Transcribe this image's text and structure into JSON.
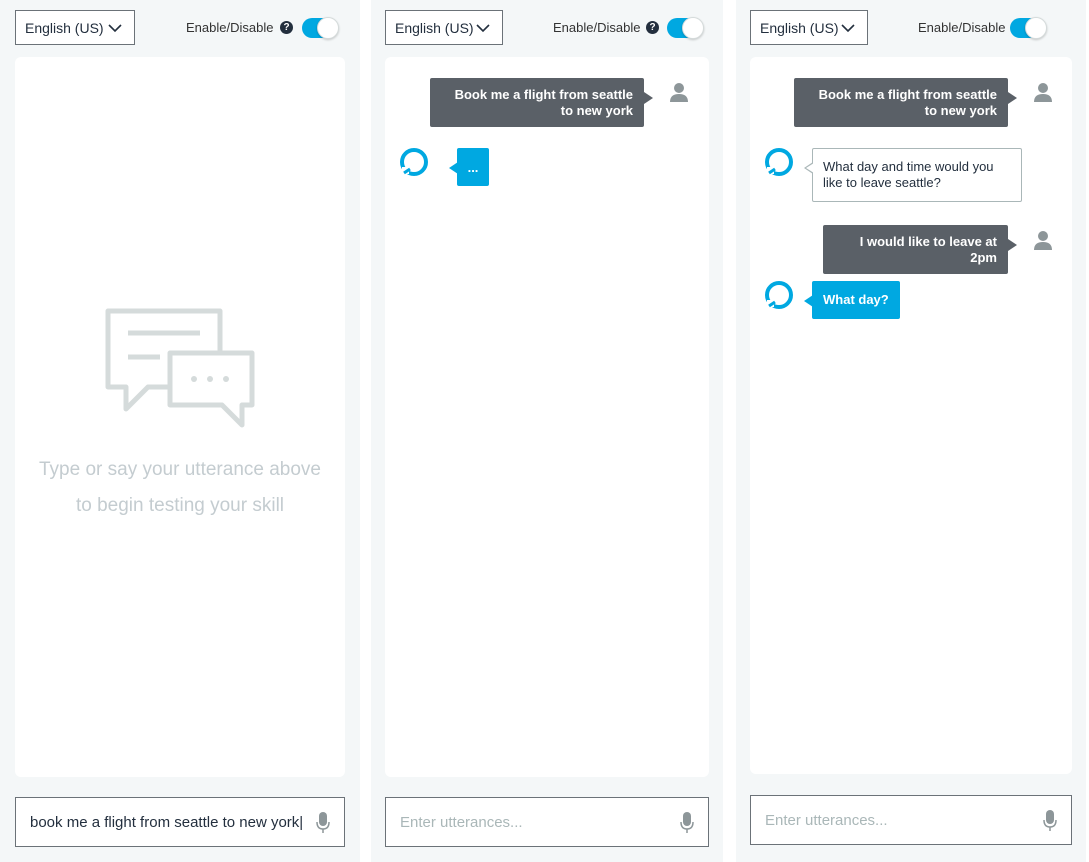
{
  "panels": [
    {
      "language": "English (US)",
      "toggle_label": "Enable/Disable",
      "help": "?",
      "empty_state": {
        "line1": "Type or say your utterance above",
        "line2": "to begin testing your skill"
      },
      "input": {
        "value": "book me a flight from seattle to new york|",
        "placeholder": ""
      }
    },
    {
      "language": "English (US)",
      "toggle_label": "Enable/Disable",
      "help": "?",
      "messages": [
        {
          "from": "user",
          "text": "Book me a flight from seattle to new york"
        },
        {
          "from": "alexa",
          "text": "...",
          "active": true
        }
      ],
      "input": {
        "value": "",
        "placeholder": "Enter utterances..."
      }
    },
    {
      "language": "English (US)",
      "toggle_label": "Enable/Disable",
      "messages": [
        {
          "from": "user",
          "text": "Book me a flight from seattle to new york"
        },
        {
          "from": "alexa",
          "text": "What day and time would you like to leave seattle?"
        },
        {
          "from": "user",
          "text": "I would like to leave at 2pm"
        },
        {
          "from": "alexa",
          "text": "What day?",
          "active": true
        }
      ],
      "input": {
        "value": "",
        "placeholder": "Enter utterances..."
      }
    }
  ],
  "colors": {
    "accent": "#00a8e1",
    "user_bubble": "#5a6067",
    "panel_bg": "#f4f7f8"
  }
}
